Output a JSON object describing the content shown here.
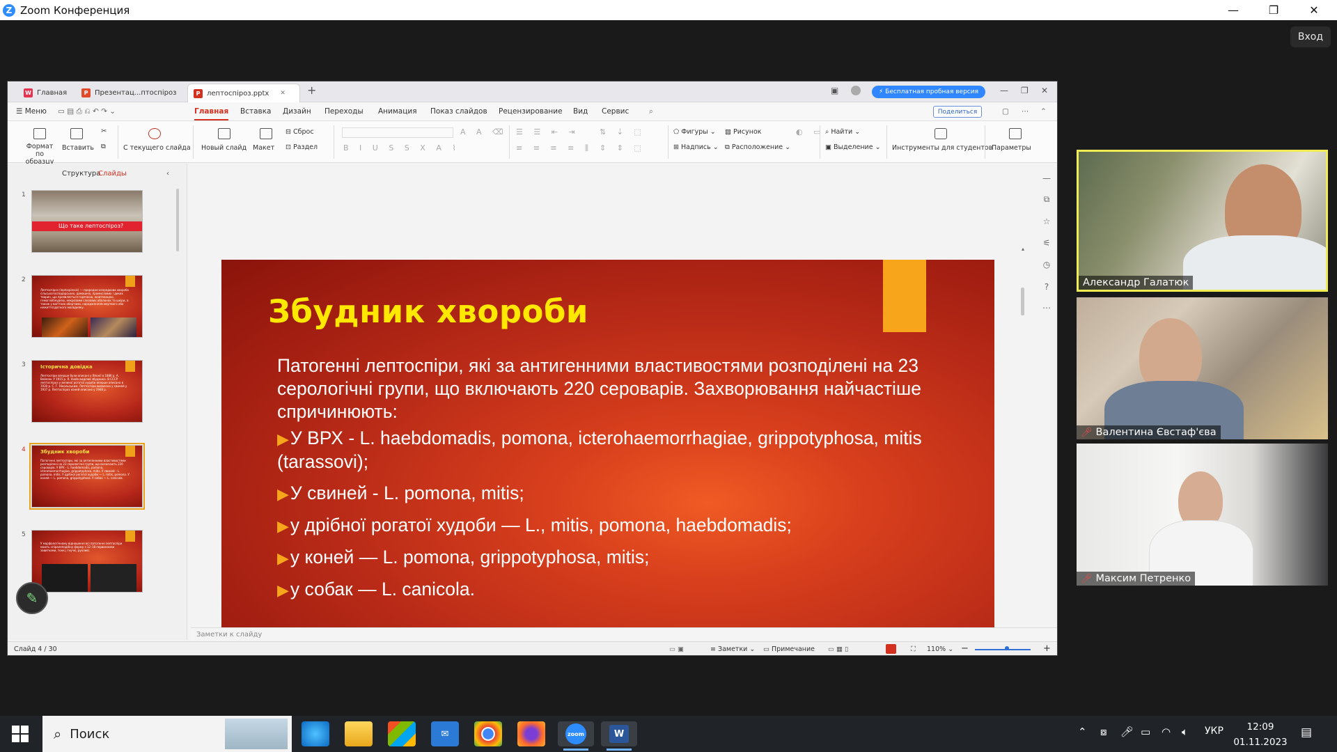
{
  "zoom": {
    "window_title": "Zoom Конференция",
    "logo_letter": "Z",
    "sign_in": "Вход",
    "window_controls": [
      "—",
      "❐",
      "✕"
    ]
  },
  "wps": {
    "doc_tabs": [
      {
        "label": "Главная",
        "icon": "wps-home-icon"
      },
      {
        "label": "Презентац...птоспіроз",
        "icon": "presentation-doc-icon"
      },
      {
        "label": "лептоспіроз.pptx",
        "icon": "pptx-doc-icon"
      }
    ],
    "new_tab": "+",
    "trial_button": "⚡ Бесплатная пробная версия",
    "window_controls": [
      "—",
      "❐",
      "✕"
    ],
    "menu_label": "☰ Меню",
    "menu_tabs": [
      "Главная",
      "Вставка",
      "Дизайн",
      "Переходы",
      "Анимация",
      "Показ слайдов",
      "Рецензирование",
      "Вид",
      "Сервис"
    ],
    "active_menu_tab": "Главная",
    "share_button": "Поделиться",
    "ribbon": {
      "format_painter": "Формат по образцу",
      "paste": "Вставить",
      "from_current": "С текущего слайда",
      "new_slide": "Новый слайд",
      "layout": "Макет",
      "reset": "Сброс",
      "section": "Раздел",
      "shapes": "Фигуры",
      "picture": "Рисунок",
      "textbox": "Надпись",
      "arrange": "Расположение",
      "find": "Найти",
      "select": "Выделение",
      "student_tools": "Инструменты для студентов",
      "params": "Параметры"
    },
    "panel_tabs": [
      "Структура",
      "Слайды"
    ],
    "active_panel_tab": "Слайды",
    "thumbnails": [
      {
        "num": "1",
        "title": "Що таке лептоспіроз?"
      },
      {
        "num": "2",
        "title": "",
        "text": "Лептоспіроз (leptospirosis) — природно-осередкова хвороба сільськогосподарських, домашніх, промислових і диких тварин, що проявляється гарячкою, жовтяницею, гемоглобінурією, некрозами слизових оболонок та шкіри, а також у вагітних абортами, народженням мертвого або нежиттєздатного молодняку."
      },
      {
        "num": "3",
        "title": "Історична довідка",
        "text": "Лептоспіри вперше були описані у Японії в 1886 р. А. Вейлем. У 1915 р. R. Inada виділив збудника. В СССР лептоспіроз у великої рогатої худоби вперше описано в 1930 р. С. Г. Нікольським. Лептоспіри виявлено у свиней у 1937 р. Лептоспіроз коней описано у 1948 р."
      },
      {
        "num": "4",
        "title": "Збудник хвороби",
        "text": "Патогенні лептоспіри, які за антигенними властивостями розподілені на 23 серологічні групи, що включають 220 сероварів. У ВРХ - L. haebdomadis, pomona, icterohaemorrhagiae, grippotyphosa, mitis. У свиней - L. pomona, mitis. У дрібної рогатої худоби — L. mitis, pomona. У коней — L. pomona, grippotyphosa. У собак — L. canicola."
      },
      {
        "num": "5",
        "title": "",
        "text": "У морфологічному відношенні всі патогенні лептоспіри мають спіралеподібну форму з 12–18 первинними завитками, тонкі, гнучкі, рухливі."
      }
    ],
    "add_slide": "+",
    "slide": {
      "title": "Збудник хвороби",
      "intro": "Патогенні лептоспіри, які за антигенними властивостями розподілені на 23 серологічні групи, що включають 220 сероварів. Захворювання найчастіше спричинюють:",
      "bullets": [
        "У ВРХ - L. haebdomadis, pomona, icterohaemorrhagiae, grippotyphosa, mitis (tarassovi);",
        "У свиней - L. pomona, mitis;",
        "у дрібної рогатої худоби — L., mitis, pomona, haebdomadis;",
        "у коней — L. pomona, grippotyphosa, mitis;",
        "у собак — L. canicola."
      ],
      "bullet_marker": "▶"
    },
    "notes_placeholder": "Заметки к слайду",
    "status": {
      "slide_counter": "Слайд 4 / 30",
      "notes": "Заметки",
      "comment": "Примечание",
      "zoom": "110%",
      "zoom_out": "−",
      "zoom_in": "+"
    }
  },
  "participants": [
    {
      "name": "Александр Галатюк",
      "muted": false,
      "active_speaker": true
    },
    {
      "name": "Валентина Євстаф'єва",
      "muted": true,
      "active_speaker": false
    },
    {
      "name": "Максим Петренко",
      "muted": true,
      "active_speaker": false
    }
  ],
  "taskbar": {
    "search_label": "Поиск",
    "apps": [
      "edge-icon",
      "file-explorer-icon",
      "microsoft-store-icon",
      "mail-icon",
      "chrome-icon",
      "firefox-icon",
      "zoom-icon",
      "word-icon"
    ],
    "zoom_app_label": "zoom",
    "word_app_label": "W",
    "language": "УКР",
    "time": "12:09",
    "date": "01.11.2023"
  },
  "colors": {
    "slide_title": "#ffe800",
    "bullet_arrow": "#f7a51a",
    "active_tab": "#d2311f",
    "trial_button": "#2f86ff",
    "active_speaker_border": "#f0ec53"
  }
}
